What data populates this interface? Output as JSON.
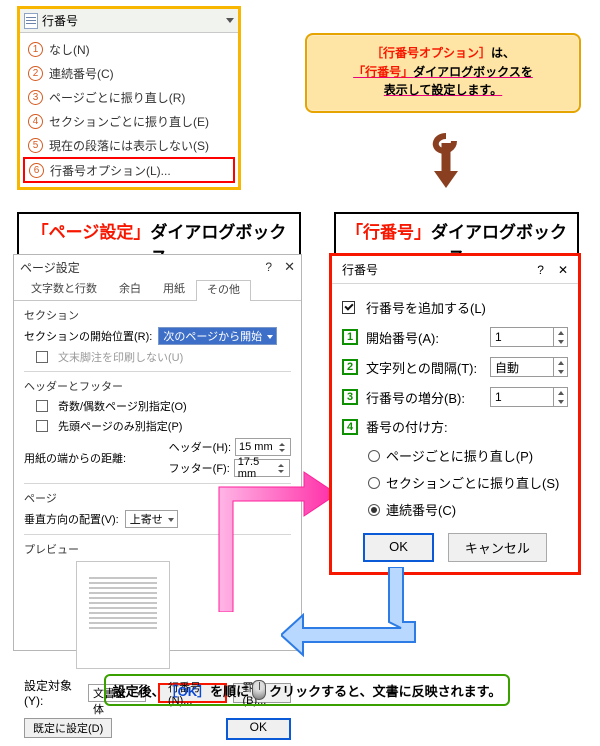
{
  "dropdown": {
    "title": "行番号",
    "items": [
      {
        "num": "1",
        "label": "なし(N)"
      },
      {
        "num": "2",
        "label": "連続番号(C)"
      },
      {
        "num": "3",
        "label": "ページごとに振り直し(R)"
      },
      {
        "num": "4",
        "label": "セクションごとに振り直し(E)"
      },
      {
        "num": "5",
        "label": "現在の段落には表示しない(S)"
      },
      {
        "num": "6",
        "label": "行番号オプション(L)..."
      }
    ]
  },
  "callout": {
    "l1_red": "［行番号オプション］",
    "l1_tail": "は、",
    "l2_red": "「行番号」",
    "l2_tail": "ダイアログボックスを",
    "l3": "表示して設定します。"
  },
  "caption_left_red": "「ページ設定」",
  "caption_left_tail": "ダイアログボックス",
  "caption_right_red": "「行番号」",
  "caption_right_tail": "ダイアログボックス",
  "pagesetup": {
    "title": "ページ設定",
    "q": "?",
    "x": "✕",
    "tabs": [
      "文字数と行数",
      "余白",
      "用紙",
      "その他"
    ],
    "sectionHeading": "セクション",
    "sectionStartLabel": "セクションの開始位置(R):",
    "sectionStartValue": "次のページから開始",
    "noEndnote": "文末脚注を印刷しない(U)",
    "hfHeading": "ヘッダーとフッター",
    "oddEven": "奇数/偶数ページ別指定(O)",
    "firstOnly": "先頭ページのみ別指定(P)",
    "marginLabel": "用紙の端からの距離:",
    "headerLabel": "ヘッダー(H):",
    "headerVal": "15 mm",
    "footerLabel": "フッター(F):",
    "footerVal": "17.5 mm",
    "pageHeading": "ページ",
    "valignLabel": "垂直方向の配置(V):",
    "valignVal": "上寄せ",
    "previewHeading": "プレビュー",
    "applyLabel": "設定対象(Y):",
    "applyVal": "文書全体",
    "lineNumBtn": "行番号(N)...",
    "borderBtn": "罫線(B)...",
    "defaultBtn": "既定に設定(D)",
    "ok": "OK"
  },
  "linenum": {
    "title": "行番号",
    "q": "?",
    "x": "✕",
    "addCheck": "行番号を追加する(L)",
    "rows": [
      {
        "n": "1",
        "label": "開始番号(A):",
        "val": "1"
      },
      {
        "n": "2",
        "label": "文字列との間隔(T):",
        "val": "自動"
      },
      {
        "n": "3",
        "label": "行番号の増分(B):",
        "val": "1"
      },
      {
        "n": "4",
        "label": "番号の付け方:"
      }
    ],
    "radios": [
      "ページごとに振り直し(P)",
      "セクションごとに振り直し(S)",
      "連続番号(C)"
    ],
    "ok": "OK",
    "cancel": "キャンセル"
  },
  "bottom": {
    "t1": "設定後、",
    "ok": "［OK］",
    "t2": "を順に",
    "t3": "クリックすると、文書に反映されます。"
  }
}
